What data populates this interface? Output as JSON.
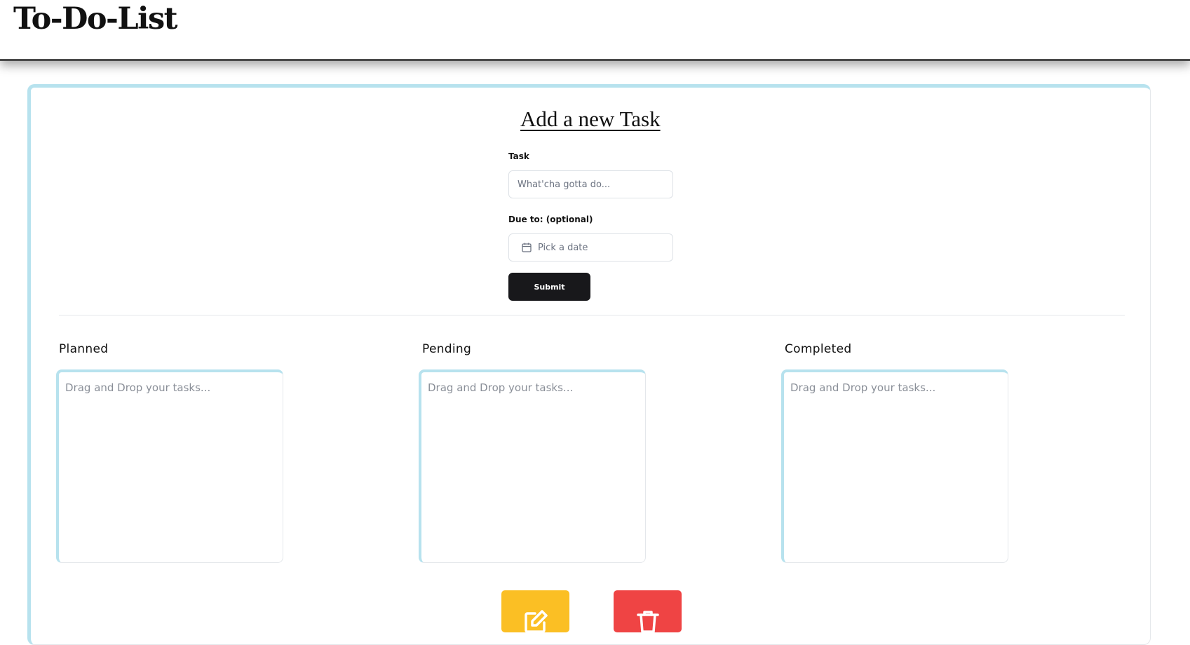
{
  "app": {
    "title": "To-Do-List"
  },
  "form": {
    "heading": "Add a new Task",
    "task_label": "Task",
    "task_placeholder": "What'cha gotta do...",
    "task_value": "",
    "due_label": "Due to: (optional)",
    "due_placeholder": "Pick a date",
    "due_icon": "calendar-icon",
    "submit_label": "Submit"
  },
  "columns": [
    {
      "title": "Planned",
      "placeholder": "Drag and Drop your tasks..."
    },
    {
      "title": "Pending",
      "placeholder": "Drag and Drop your tasks..."
    },
    {
      "title": "Completed",
      "placeholder": "Drag and Drop your tasks..."
    }
  ],
  "actions": {
    "edit": {
      "icon": "pencil-icon",
      "color": "#fbbf24"
    },
    "delete": {
      "icon": "trash-icon",
      "color": "#ef4444"
    }
  },
  "colors": {
    "accent_border": "#b7e2ee",
    "submit_bg": "#18181b",
    "header_border": "#4a4a4a"
  }
}
